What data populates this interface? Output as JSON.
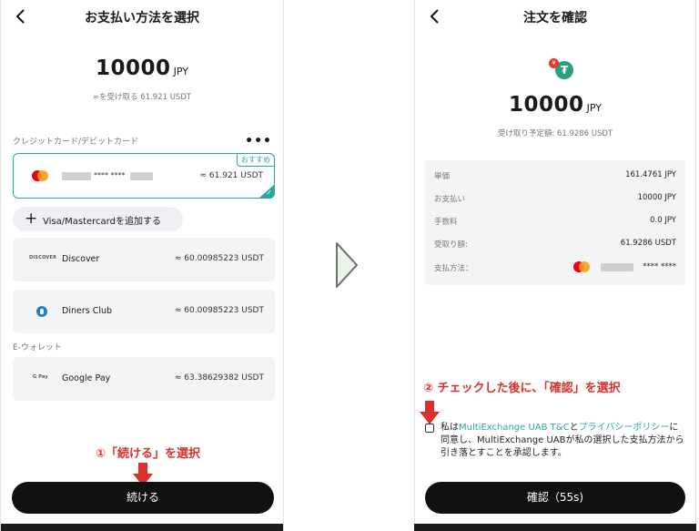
{
  "left": {
    "header_title": "お支払い方法を選択",
    "amount": "10000",
    "currency": "JPY",
    "receive_line": "≈を受け取る 61.921 USDT",
    "card_section_label": "クレジットカード/デビットカード",
    "more_label": "•••",
    "selected_card": {
      "badge": "おすすめ",
      "masked": "**** ****",
      "value": "≈ 61.921 USDT",
      "check": "✓"
    },
    "add_card": {
      "plus": "+",
      "label": "Visa/Mastercardを追加する"
    },
    "methods": [
      {
        "logo": "DISCOVER",
        "name": "Discover",
        "value": "≈ 60.00985223 USDT"
      },
      {
        "logo": "",
        "name": "Diners Club",
        "value": "≈ 60.00985223 USDT"
      }
    ],
    "ewallet_label": "E-ウォレット",
    "ewallet": {
      "logo": "G Pay",
      "name": "Google Pay",
      "value": "≈ 63.38629382 USDT"
    },
    "instruction": "①「続ける」を選択",
    "continue_label": "続ける"
  },
  "right": {
    "header_title": "注文を確認",
    "coin_symbol": "₮",
    "coin_small": "¥",
    "amount": "10000",
    "currency": "JPY",
    "receive_line": "受け取り予定額: 61.9286 USDT",
    "summary": {
      "unit_price_label": "単価",
      "unit_price_value": "161.4761 JPY",
      "payment_label": "お支払い",
      "payment_value": "10000 JPY",
      "fee_label": "手数料",
      "fee_value": "0.0 JPY",
      "received_label": "受取り額:",
      "received_value": "61.9286 USDT",
      "method_label": "支払方法：",
      "method_masked": "**** ****"
    },
    "instruction": "② チェックした後に、「確認」を選択",
    "agree": {
      "text1": "私は",
      "link1": "MultiExchange UAB T&C",
      "text2": "と",
      "link2": "プライバシーポリシー",
      "text3": "に同意し、MultiExchange UABが私の選択した支払方法から引き落とすことを承認します。"
    },
    "confirm_label": "確認（55s)"
  },
  "colors": {
    "accent": "#2aa79b",
    "instruction_red": "#d7322b",
    "button_dark": "#111111",
    "arrow_green": "#e9f6e7"
  },
  "icons": [
    "back-arrow-icon",
    "more-dots-icon",
    "mastercard-icon",
    "plus-icon",
    "discover-icon",
    "diners-club-icon",
    "google-pay-icon",
    "tether-coin-icon",
    "red-down-arrow-icon",
    "next-step-arrow-icon"
  ]
}
